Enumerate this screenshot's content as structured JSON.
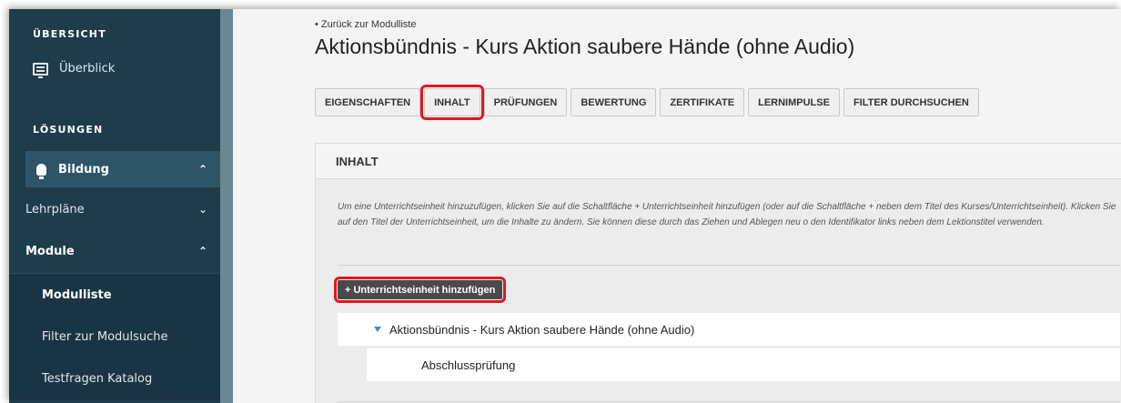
{
  "sidebar": {
    "section_overview": "ÜBERSICHT",
    "overview_item": "Überblick",
    "section_solutions": "LÖSUNGEN",
    "bildung": "Bildung",
    "lehrplaene": "Lehrpläne",
    "module": "Module",
    "modulliste": "Modulliste",
    "filter_modulsuche": "Filter zur Modulsuche",
    "testfragen": "Testfragen Katalog"
  },
  "main": {
    "back_link": "Zurück zur Modulliste",
    "title": "Aktionsbündnis - Kurs Aktion saubere Hände (ohne Audio)",
    "tabs": [
      "EIGENSCHAFTEN",
      "INHALT",
      "PRÜFUNGEN",
      "BEWERTUNG",
      "ZERTIFIKATE",
      "LERNIMPULSE",
      "FILTER DURCHSUCHEN"
    ],
    "panel_title": "INHALT",
    "info_text": "Um eine Unterrichtseinheit hinzuzufügen, klicken Sie auf die Schaltfläche + Unterrichtseinheit hinzufügen (oder auf die Schaltfläche + neben dem Titel des Kurses/Unterrichtseinheit). Klicken Sie auf den Titel der Unterrichtseinheit, um die Inhalte zu ändern. Sie können diese durch das Ziehen und Ablegen neu o den Identifikator links neben dem Lektionstitel verwenden.",
    "add_button": "+ Unterrichtseinheit hinzufügen",
    "unit_title": "Aktionsbündnis - Kurs Aktion saubere Hände (ohne Audio)",
    "lesson_title": "Abschlussprüfung"
  },
  "colors": {
    "sidebar_bg": "#1f3c4b",
    "highlight": "#e0191f",
    "caret": "#3c8fd6"
  }
}
